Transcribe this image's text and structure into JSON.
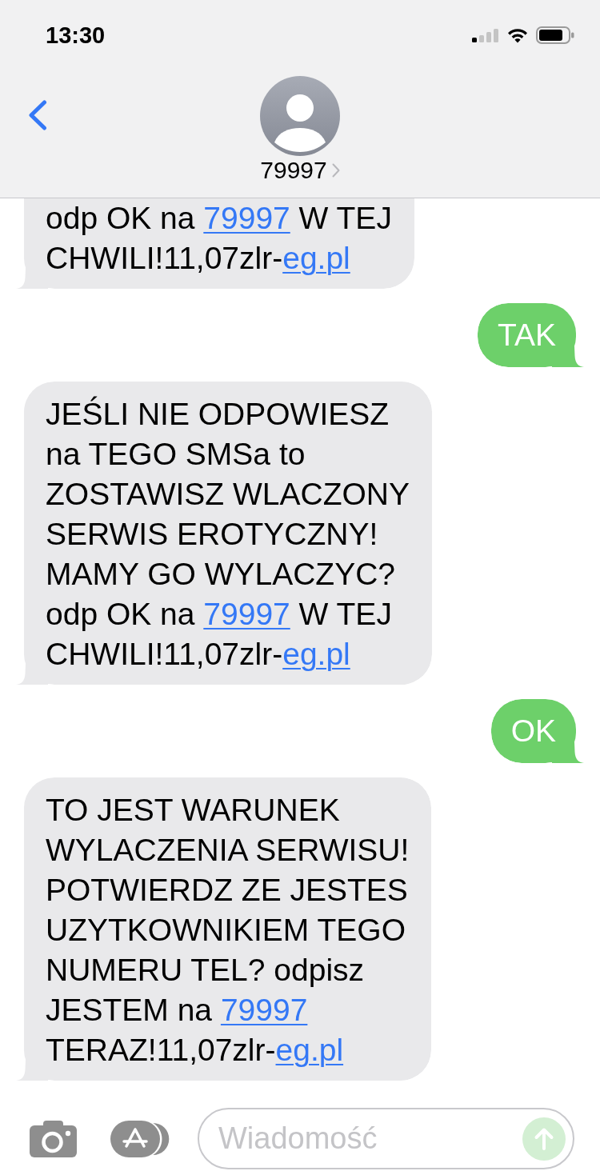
{
  "status_bar": {
    "time": "13:30"
  },
  "header": {
    "contact": "79997"
  },
  "messages": [
    {
      "kind": "incoming",
      "clipped": true,
      "lines": [
        [
          {
            "kind": "text",
            "text": "odp OK na "
          },
          {
            "kind": "link",
            "text": "79997"
          },
          {
            "kind": "text",
            "text": " W TEJ"
          }
        ],
        [
          {
            "kind": "text",
            "text": "CHWILI!11,07zlr-"
          },
          {
            "kind": "link",
            "text": "eg.pl"
          }
        ]
      ]
    },
    {
      "kind": "outgoing",
      "clipped": false,
      "lines": [
        [
          {
            "kind": "text",
            "text": "TAK"
          }
        ]
      ]
    },
    {
      "kind": "incoming",
      "clipped": false,
      "lines": [
        [
          {
            "kind": "text",
            "text": "JEŚLI NIE ODPOWIESZ"
          }
        ],
        [
          {
            "kind": "text",
            "text": "na TEGO SMSa to"
          }
        ],
        [
          {
            "kind": "text",
            "text": "ZOSTAWISZ WLACZONY"
          }
        ],
        [
          {
            "kind": "text",
            "text": "SERWIS EROTYCZNY!"
          }
        ],
        [
          {
            "kind": "text",
            "text": "MAMY GO WYLACZYC?"
          }
        ],
        [
          {
            "kind": "text",
            "text": "odp OK na "
          },
          {
            "kind": "link",
            "text": "79997"
          },
          {
            "kind": "text",
            "text": " W TEJ"
          }
        ],
        [
          {
            "kind": "text",
            "text": "CHWILI!11,07zlr-"
          },
          {
            "kind": "link",
            "text": "eg.pl"
          }
        ]
      ]
    },
    {
      "kind": "outgoing",
      "clipped": false,
      "lines": [
        [
          {
            "kind": "text",
            "text": "OK"
          }
        ]
      ]
    },
    {
      "kind": "incoming",
      "clipped": false,
      "lines": [
        [
          {
            "kind": "text",
            "text": "TO JEST WARUNEK"
          }
        ],
        [
          {
            "kind": "text",
            "text": "WYLACZENIA SERWISU!"
          }
        ],
        [
          {
            "kind": "text",
            "text": "POTWIERDZ ZE JESTES"
          }
        ],
        [
          {
            "kind": "text",
            "text": "UZYTKOWNIKIEM TEGO"
          }
        ],
        [
          {
            "kind": "text",
            "text": "NUMERU TEL? odpisz"
          }
        ],
        [
          {
            "kind": "text",
            "text": "JESTEM na "
          },
          {
            "kind": "link",
            "text": "79997"
          }
        ],
        [
          {
            "kind": "text",
            "text": "TERAZ!11,07zlr-"
          },
          {
            "kind": "link",
            "text": "eg.pl"
          }
        ]
      ]
    }
  ],
  "composer": {
    "placeholder": "Wiadomość",
    "send_button": {
      "disabled": true
    }
  }
}
